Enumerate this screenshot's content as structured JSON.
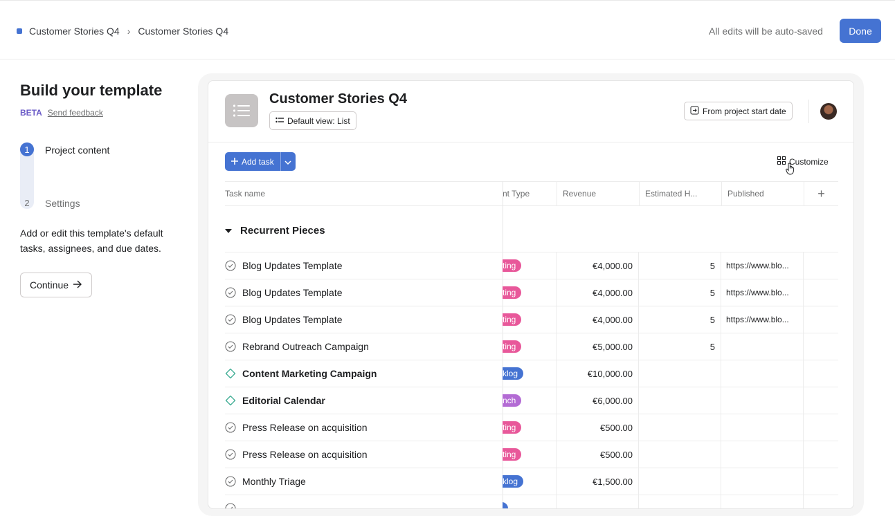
{
  "breadcrumb": {
    "parent": "Customer Stories Q4",
    "current": "Customer Stories Q4"
  },
  "topbar": {
    "autosave_text": "All edits will be auto-saved",
    "done_label": "Done"
  },
  "left": {
    "title": "Build your template",
    "beta": "BETA",
    "feedback": "Send feedback",
    "steps": [
      {
        "num": "1",
        "label": "Project content"
      },
      {
        "num": "2",
        "label": "Settings"
      }
    ],
    "description": "Add or edit this template's default tasks, assignees, and due dates.",
    "continue_label": "Continue"
  },
  "project": {
    "title": "Customer Stories Q4",
    "view_label": "Default view: List",
    "start_label": "From project start date",
    "add_task_label": "Add task",
    "customize_label": "Customize"
  },
  "columns": {
    "task": "Task name",
    "type": "nt Type",
    "revenue": "Revenue",
    "hours": "Estimated H...",
    "published": "Published",
    "add": "+"
  },
  "section": {
    "title": "Recurrent Pieces"
  },
  "rows": [
    {
      "name": "Blog Updates Template",
      "kind": "task",
      "type": "ting",
      "type_color": "#e8589a",
      "revenue": "€4,000.00",
      "hours": "5",
      "published": "https://www.blo..."
    },
    {
      "name": "Blog Updates Template",
      "kind": "task",
      "type": "ting",
      "type_color": "#e8589a",
      "revenue": "€4,000.00",
      "hours": "5",
      "published": "https://www.blo..."
    },
    {
      "name": "Blog Updates Template",
      "kind": "task",
      "type": "ting",
      "type_color": "#e8589a",
      "revenue": "€4,000.00",
      "hours": "5",
      "published": "https://www.blo..."
    },
    {
      "name": "Rebrand Outreach Campaign",
      "kind": "task",
      "type": "ting",
      "type_color": "#e8589a",
      "revenue": "€5,000.00",
      "hours": "5",
      "published": ""
    },
    {
      "name": "Content Marketing Campaign",
      "kind": "milestone",
      "type": "klog",
      "type_color": "#4573d2",
      "revenue": "€10,000.00",
      "hours": "",
      "published": ""
    },
    {
      "name": "Editorial Calendar",
      "kind": "milestone",
      "type": "nch",
      "type_color": "#b36bd4",
      "revenue": "€6,000.00",
      "hours": "",
      "published": ""
    },
    {
      "name": "Press Release on acquisition",
      "kind": "task",
      "type": "ting",
      "type_color": "#e8589a",
      "revenue": "€500.00",
      "hours": "",
      "published": ""
    },
    {
      "name": "Press Release on acquisition",
      "kind": "task",
      "type": "ting",
      "type_color": "#e8589a",
      "revenue": "€500.00",
      "hours": "",
      "published": ""
    },
    {
      "name": "Monthly Triage",
      "kind": "task",
      "type": "klog",
      "type_color": "#4573d2",
      "revenue": "€1,500.00",
      "hours": "",
      "published": ""
    },
    {
      "name": "",
      "kind": "task",
      "type": "",
      "type_color": "#4573d2",
      "revenue": "",
      "hours": "",
      "published": ""
    }
  ]
}
